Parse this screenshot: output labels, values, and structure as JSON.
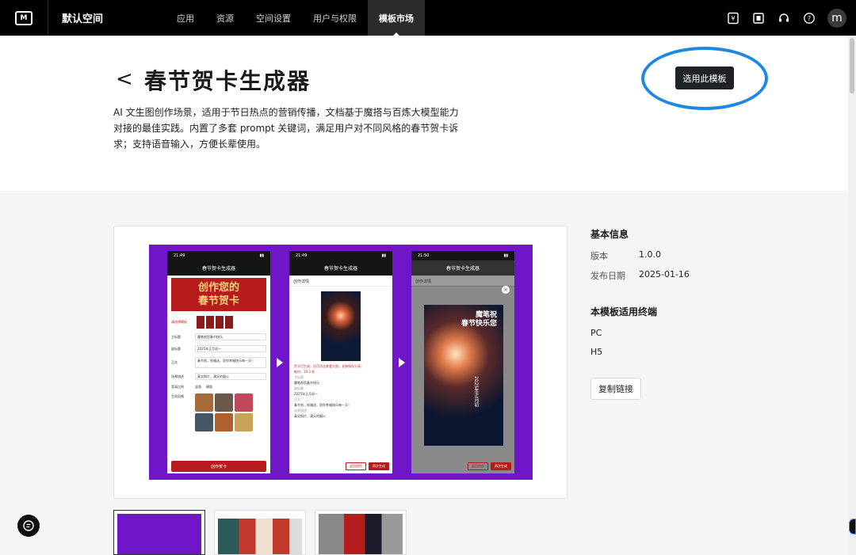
{
  "nav": {
    "space_name": "默认空间",
    "items": [
      "应用",
      "资源",
      "空间设置",
      "用户与权限",
      "模板市场"
    ],
    "avatar_letter": "m",
    "logo_text": "M"
  },
  "page": {
    "back_glyph": "<",
    "title": "春节贺卡生成器",
    "description": "AI 文生图创作场景，适用于节日热点的营销传播，文档基于魔搭与百炼大模型能力对接的最佳实践。内置了多套 prompt 关键词，满足用户对不同风格的春节贺卡诉求；支持语音输入，方便长辈使用。",
    "use_button": "选用此模板",
    "highlight_color": "#1e88e5"
  },
  "info": {
    "basic_title": "基本信息",
    "version_label": "版本",
    "version_value": "1.0.0",
    "date_label": "发布日期",
    "date_value": "2025-01-16",
    "terminal_title": "本模板适用终端",
    "terminals": [
      "PC",
      "H5"
    ],
    "copy_button": "复制链接"
  },
  "preview": {
    "bg_color": "#6f17c8",
    "phone1": {
      "time": "21:49",
      "app_title": "春节贺卡生成器",
      "banner": "创作您的\n春节贺卡",
      "rows": [
        {
          "label": "主标题",
          "value": "魔笔祝您春节快乐"
        },
        {
          "label": "副标题",
          "value": "2025年正月初一"
        },
        {
          "label": "正文",
          "value": "春节到，祝福送，愿你幸福快乐每一天！"
        },
        {
          "label": "场景描述",
          "value": "真实照片，满天的烟火"
        }
      ],
      "ratio_label": "宽高比例",
      "ratio_options": [
        "竖版",
        "横版"
      ],
      "style_label": "生成风格",
      "button": "创作贺卡"
    },
    "phone2": {
      "time": "21:49",
      "app_title": "春节贺卡生成器",
      "modal_title": "创作详情",
      "notice": "贺卡已生成，但可点击查看大图，长按保存分享。",
      "elapsed": "耗时：19.3 秒",
      "fields": [
        {
          "label": "主标题",
          "value": "魔笔祝您春节快乐"
        },
        {
          "label": "副标题",
          "value": "2025年正月初一"
        },
        {
          "label": "正文",
          "value": "春节到，祝福送，愿你幸福快乐每一天！"
        },
        {
          "label": "场景描述",
          "value": "真实照片，满天的烟火"
        },
        {
          "label": "宽高比例",
          "value": "竖版"
        }
      ],
      "btn_back": "返回创作",
      "btn_again": "再次生成"
    },
    "phone3": {
      "time": "21:50",
      "app_title": "春节贺卡生成器",
      "modal_title": "创作详情",
      "card_text": "魔笔祝\n春节快乐您",
      "card_date": "2025年正月初",
      "btn_back": "返回创作",
      "btn_again": "再次生成"
    }
  }
}
